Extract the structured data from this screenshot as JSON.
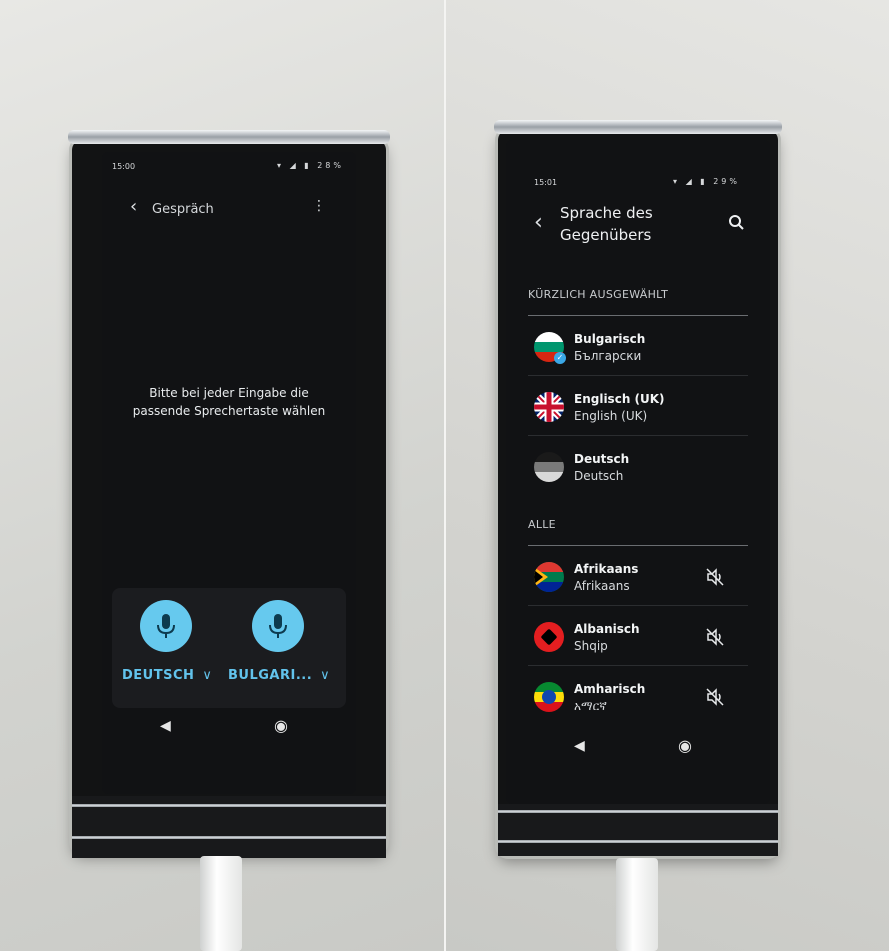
{
  "left_screen": {
    "status_time": "15:00",
    "status_icons": "▾ ◢ ▮ 28%",
    "header_title": "Gespräch",
    "prompt": "Bitte bei jeder Eingabe die passende Sprechertaste wählen",
    "lang_a": "DEUTSCH",
    "lang_b": "BULGARI...",
    "chevron": "∨",
    "nav_back": "◀",
    "nav_home": "◉"
  },
  "right_screen": {
    "status_time": "15:01",
    "status_icons": "▾ ◢ ▮ 29%",
    "header_line1": "Sprache des",
    "header_line2": "Gegenübers",
    "section_recent": "KÜRZLICH AUSGEWÄHLT",
    "section_all": "ALLE",
    "recent": [
      {
        "name": "Bulgarisch",
        "native": "Български"
      },
      {
        "name": "Englisch (UK)",
        "native": "English (UK)"
      },
      {
        "name": "Deutsch",
        "native": "Deutsch"
      }
    ],
    "all": [
      {
        "name": "Afrikaans",
        "native": "Afrikaans"
      },
      {
        "name": "Albanisch",
        "native": "Shqip"
      },
      {
        "name": "Amharisch",
        "native": "አማርኛ"
      }
    ],
    "nav_back": "◀",
    "nav_home": "◉"
  },
  "colors": {
    "accent": "#62c3ec",
    "mic": "#66c9ee",
    "screen_bg": "#111214"
  }
}
